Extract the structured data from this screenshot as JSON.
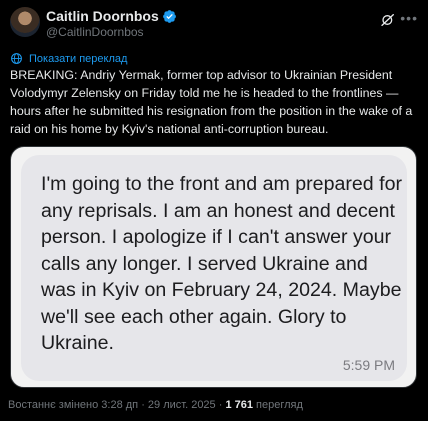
{
  "author": {
    "name": "Caitlin Doornbos",
    "handle": "@CaitlinDoornbos",
    "verified": true,
    "verified_color": "#1d9bf0"
  },
  "icons": {
    "verified": "verified-badge-icon",
    "grok": "grok-icon",
    "more": "more-options-icon",
    "translate": "translate-globe-icon"
  },
  "translate_label": "Показати переклад",
  "tweet_text": "BREAKING: Andriy Yermak, former top advisor to Ukrainian President Volodymyr Zelensky on Friday told me he is headed to the frontlines — hours after he submitted his resignation from the position in the wake of a raid on his home by Kyiv's national anti-corruption bureau.",
  "media": {
    "message_text": "I'm going to the front and am prepared for any reprisals. I am an honest and decent person. I apologize if I can't answer your calls any longer. I served Ukraine and was in Kyiv on February 24, 2024. Maybe we'll see each other again. Glory to Ukraine.",
    "message_time": "5:59 PM"
  },
  "meta": {
    "edited_label": "Востаннє змінено 3:28 дп · 29 лист. 2025 ·",
    "views_count": "1 761",
    "views_label": "перегляд"
  },
  "colors": {
    "background": "#000000",
    "link": "#1d9bf0",
    "muted": "#71767b"
  }
}
